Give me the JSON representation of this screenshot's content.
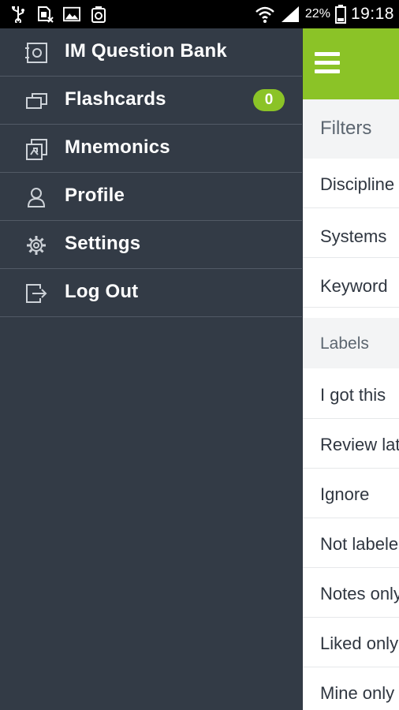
{
  "status_bar": {
    "icons_left": [
      "usb-icon",
      "sim-icon",
      "image-icon",
      "recycle-icon"
    ],
    "icons_right": [
      "wifi-icon",
      "signal-icon",
      "battery-icon"
    ],
    "battery": "22%",
    "time": "19:18"
  },
  "drawer": {
    "items": [
      {
        "label": "IM Question Bank",
        "icon": "question-bank-icon"
      },
      {
        "label": "Flashcards",
        "icon": "flashcards-icon",
        "badge": "0"
      },
      {
        "label": "Mnemonics",
        "icon": "mnemonics-icon"
      },
      {
        "label": "Profile",
        "icon": "profile-icon"
      },
      {
        "label": "Settings",
        "icon": "settings-gear-icon"
      },
      {
        "label": "Log Out",
        "icon": "logout-icon"
      }
    ]
  },
  "content": {
    "filters_header": "Filters",
    "filters": [
      "Discipline",
      "Systems",
      "Keyword"
    ],
    "labels_header": "Labels",
    "labels": [
      "I got this",
      "Review later",
      "Ignore",
      "Not labeled",
      "Notes only",
      "Liked only",
      "Mine only"
    ]
  },
  "colors": {
    "accent": "#8bc327",
    "drawer_bg": "#333b46",
    "divider": "#525a66"
  }
}
